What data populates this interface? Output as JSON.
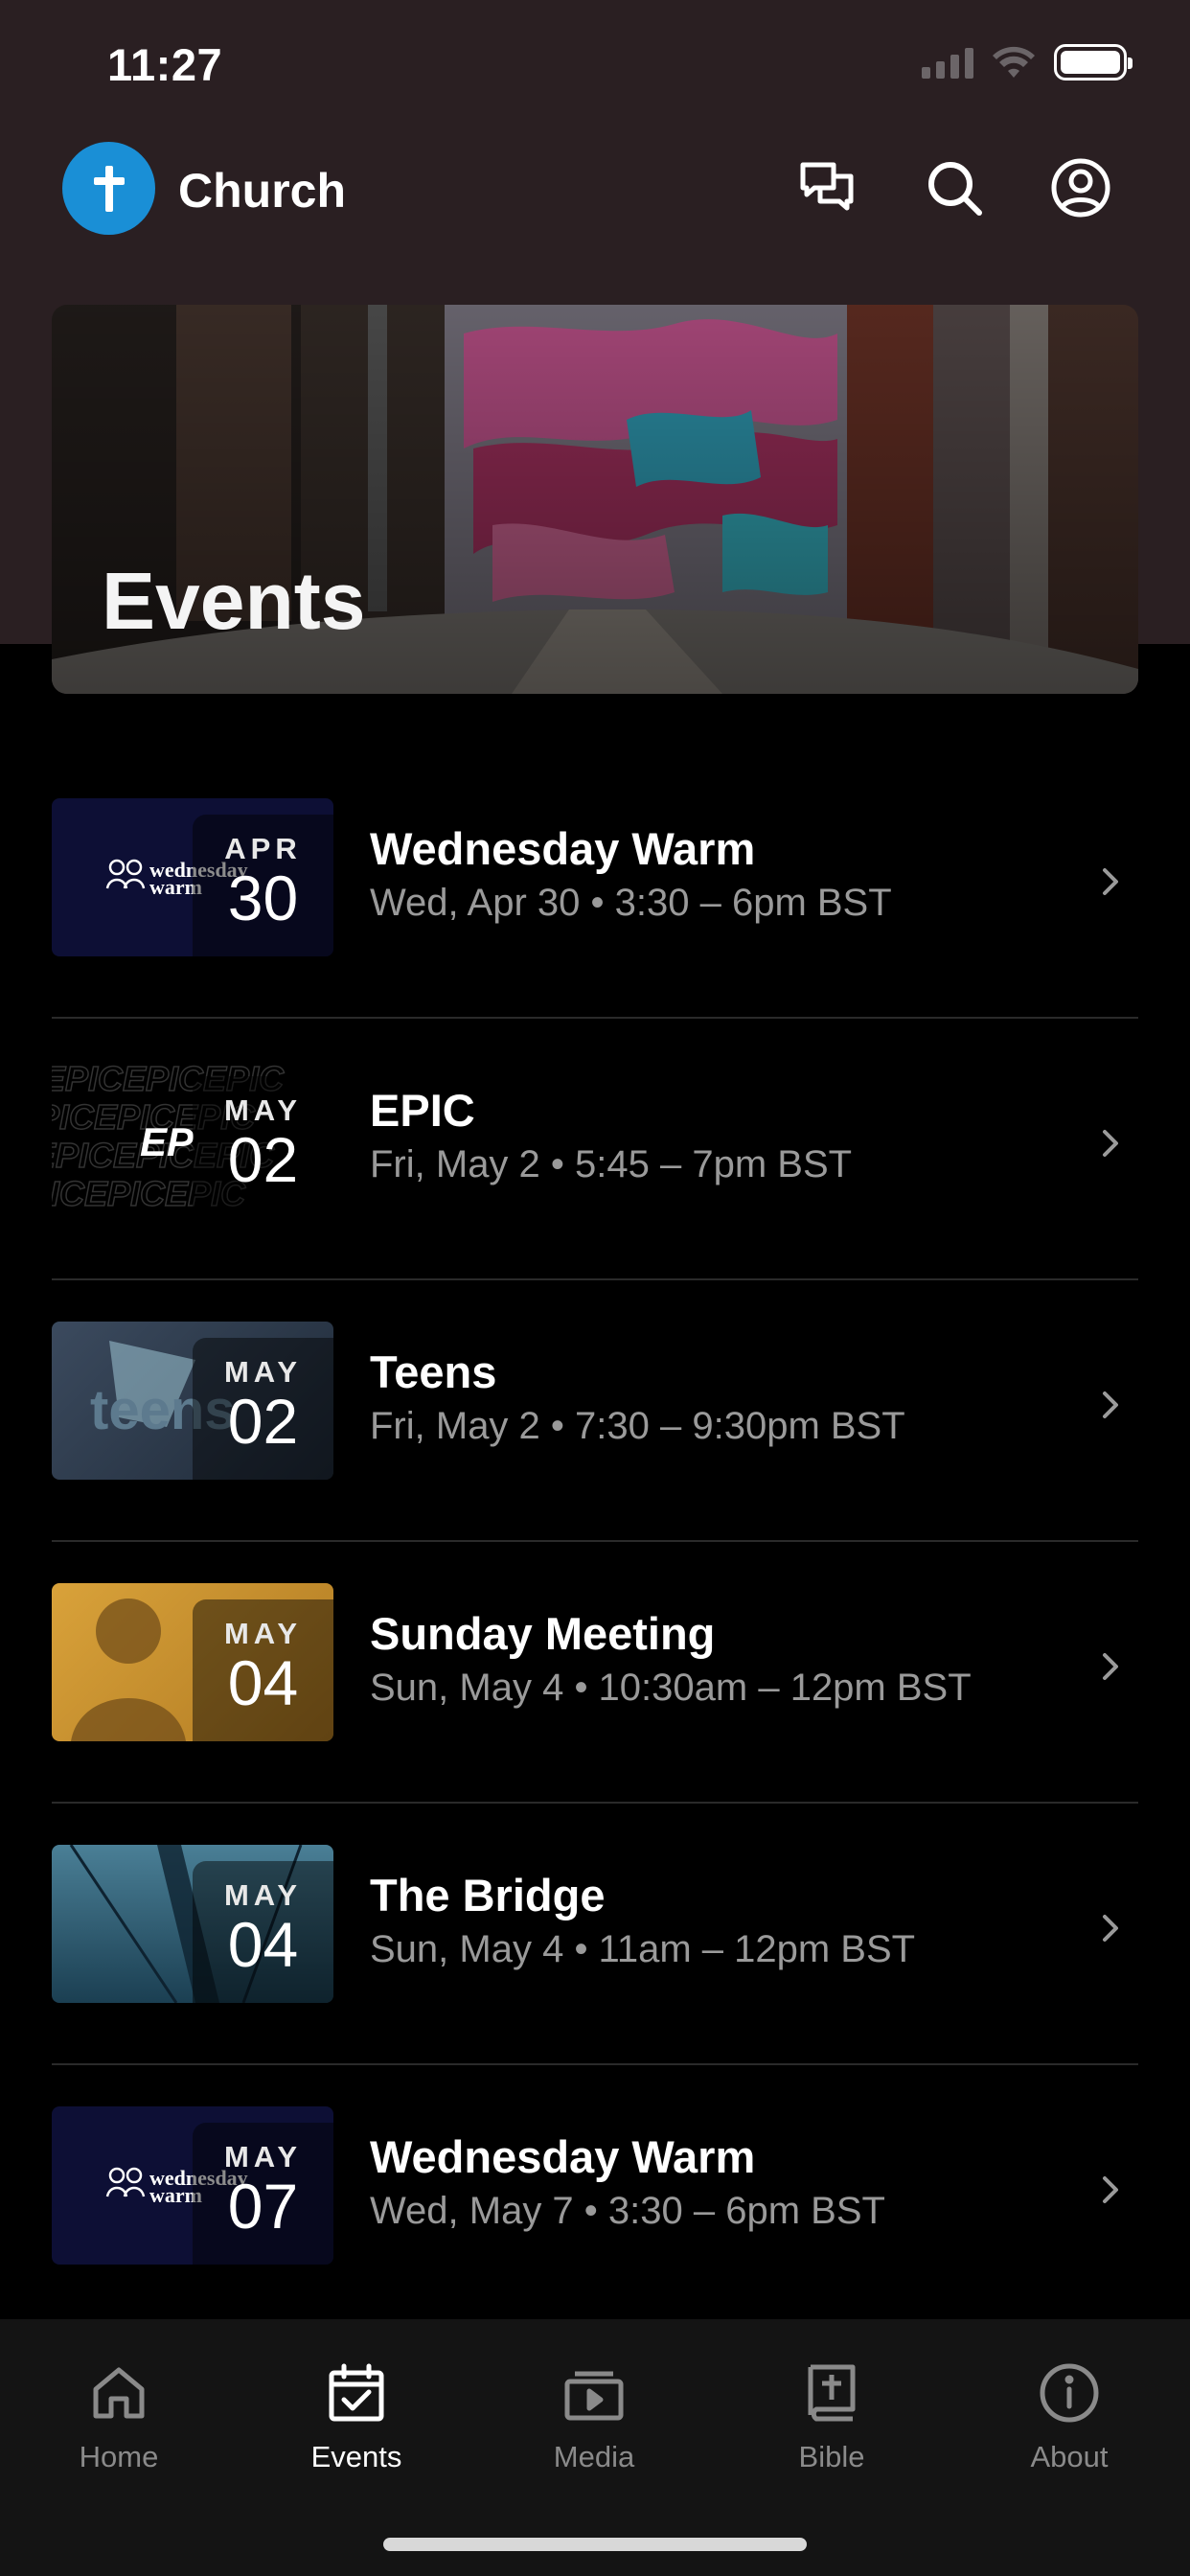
{
  "status": {
    "time": "11:27"
  },
  "app": {
    "title": "Church",
    "brand_color": "#1a8fd6"
  },
  "header_icons": [
    "chat-icon",
    "search-icon",
    "profile-icon"
  ],
  "hero": {
    "title": "Events"
  },
  "events": [
    {
      "month": "APR",
      "day": "30",
      "title": "Wednesday Warm",
      "subtitle": "Wed, Apr 30 • 3:30 – 6pm BST",
      "thumb_text": "wednesday warm"
    },
    {
      "month": "MAY",
      "day": "02",
      "title": "EPIC",
      "subtitle": "Fri, May 2 • 5:45 – 7pm BST",
      "thumb_text": "EPIC"
    },
    {
      "month": "MAY",
      "day": "02",
      "title": "Teens",
      "subtitle": "Fri, May 2 • 7:30 – 9:30pm BST",
      "thumb_text": "teens"
    },
    {
      "month": "MAY",
      "day": "04",
      "title": "Sunday Meeting",
      "subtitle": "Sun, May 4 • 10:30am – 12pm BST"
    },
    {
      "month": "MAY",
      "day": "04",
      "title": "The Bridge",
      "subtitle": "Sun, May 4 • 11am – 12pm BST"
    },
    {
      "month": "MAY",
      "day": "07",
      "title": "Wednesday Warm",
      "subtitle": "Wed, May 7 • 3:30 – 6pm BST",
      "thumb_text": "wednesday warm"
    }
  ],
  "tabs": [
    {
      "label": "Home",
      "icon": "home-icon",
      "active": false
    },
    {
      "label": "Events",
      "icon": "calendar-icon",
      "active": true
    },
    {
      "label": "Media",
      "icon": "media-icon",
      "active": false
    },
    {
      "label": "Bible",
      "icon": "bible-icon",
      "active": false
    },
    {
      "label": "About",
      "icon": "info-icon",
      "active": false
    }
  ]
}
